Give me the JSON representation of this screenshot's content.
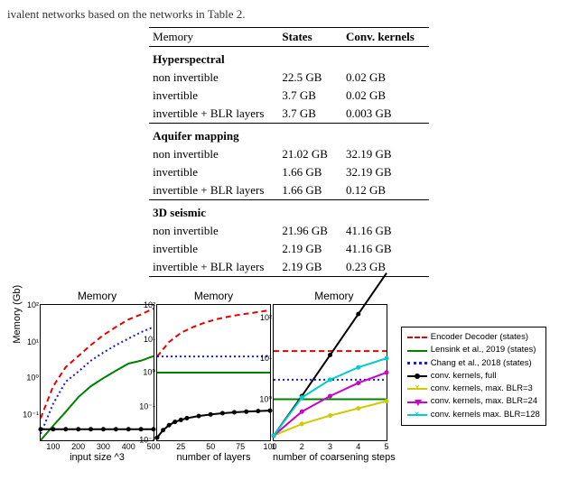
{
  "caption_fragment": "ivalent networks based on the networks in Table 2.",
  "table": {
    "headers": [
      "Memory",
      "States",
      "Conv. kernels"
    ],
    "sections": [
      {
        "title": "Hyperspectral",
        "rows": [
          {
            "name": "non invertible",
            "states": "22.5 GB",
            "kernels": "0.02 GB"
          },
          {
            "name": "invertible",
            "states": "3.7 GB",
            "kernels": "0.02 GB"
          },
          {
            "name": "invertible + BLR layers",
            "states": "3.7 GB",
            "kernels": "0.003 GB"
          }
        ]
      },
      {
        "title": "Aquifer mapping",
        "rows": [
          {
            "name": "non invertible",
            "states": "21.02 GB",
            "kernels": "32.19 GB"
          },
          {
            "name": "invertible",
            "states": "1.66 GB",
            "kernels": "32.19 GB"
          },
          {
            "name": "invertible + BLR layers",
            "states": "1.66 GB",
            "kernels": "0.12 GB"
          }
        ]
      },
      {
        "title": "3D seismic",
        "rows": [
          {
            "name": "non invertible",
            "states": "21.96 GB",
            "kernels": "41.16 GB"
          },
          {
            "name": "invertible",
            "states": "2.19 GB",
            "kernels": "41.16 GB"
          },
          {
            "name": "invertible + BLR layers",
            "states": "2.19 GB",
            "kernels": "0.23 GB"
          }
        ]
      }
    ]
  },
  "charts": {
    "ylabel": "Memory (Gb)",
    "panels": [
      {
        "title": "Memory",
        "xlabel": "input size ^3"
      },
      {
        "title": "Memory",
        "xlabel": "number of layers"
      },
      {
        "title": "Memory",
        "xlabel": "number of coarsening steps"
      }
    ],
    "legend": [
      {
        "label": "Encoder Decoder (states)",
        "color": "#e60000",
        "style": "dashed"
      },
      {
        "label": "Lensink et al., 2019 (states)",
        "color": "#008000",
        "style": "solid"
      },
      {
        "label": "Chang et al., 2018 (states)",
        "color": "#1a1ae6",
        "style": "dotted"
      },
      {
        "label": "conv. kernels, full",
        "color": "#000000",
        "style": "solid",
        "marker": "circle"
      },
      {
        "label": "conv. kernels, max. BLR=3",
        "color": "#cccc00",
        "style": "solid",
        "marker": "cross"
      },
      {
        "label": "conv. kernels, max. BLR=24",
        "color": "#cc00cc",
        "style": "solid",
        "marker": "tri"
      },
      {
        "label": "conv. kernels max. BLR=128",
        "color": "#00cccc",
        "style": "solid",
        "marker": "x"
      }
    ]
  },
  "chart_data": [
    {
      "type": "line",
      "title": "Memory",
      "xlabel": "input size ^3",
      "ylabel": "Memory (Gb)",
      "xlim": [
        50,
        500
      ],
      "ylim": [
        0.02,
        100
      ],
      "yscale": "log",
      "xticks": [
        100,
        200,
        300,
        400,
        500
      ],
      "yticks": [
        0.1,
        1,
        10,
        100
      ],
      "series": [
        {
          "name": "Encoder Decoder (states)",
          "x": [
            50,
            100,
            150,
            200,
            250,
            300,
            350,
            400,
            450,
            500
          ],
          "y": [
            0.08,
            0.6,
            2,
            4,
            8,
            15,
            25,
            40,
            55,
            80
          ]
        },
        {
          "name": "Lensink et al., 2019 (states)",
          "x": [
            50,
            100,
            150,
            200,
            250,
            300,
            350,
            400,
            450,
            500
          ],
          "y": [
            0.02,
            0.05,
            0.12,
            0.3,
            0.6,
            1,
            1.6,
            2.5,
            3,
            4
          ]
        },
        {
          "name": "Chang et al., 2018 (states)",
          "x": [
            50,
            100,
            150,
            200,
            250,
            300,
            350,
            400,
            450,
            500
          ],
          "y": [
            0.03,
            0.2,
            0.8,
            1.5,
            3,
            5,
            8,
            12,
            18,
            25
          ]
        },
        {
          "name": "conv. kernels, full",
          "x": [
            50,
            100,
            150,
            200,
            250,
            300,
            350,
            400,
            450,
            500
          ],
          "y": [
            0.04,
            0.04,
            0.04,
            0.04,
            0.04,
            0.04,
            0.04,
            0.04,
            0.04,
            0.04
          ]
        }
      ]
    },
    {
      "type": "line",
      "title": "Memory",
      "xlabel": "number of layers",
      "ylabel": "Memory (Gb)",
      "xlim": [
        5,
        100
      ],
      "ylim": [
        0.01,
        100
      ],
      "yscale": "log",
      "xticks": [
        25,
        50,
        75,
        100
      ],
      "yticks": [
        0.01,
        0.1,
        1,
        10,
        100
      ],
      "series": [
        {
          "name": "Encoder Decoder (states)",
          "x": [
            5,
            15,
            25,
            35,
            45,
            55,
            65,
            75,
            85,
            100
          ],
          "y": [
            3,
            8,
            15,
            22,
            30,
            38,
            45,
            52,
            58,
            70
          ]
        },
        {
          "name": "Lensink et al., 2019 (states)",
          "x": [
            5,
            100
          ],
          "y": [
            1,
            1
          ]
        },
        {
          "name": "Chang et al., 2018 (states)",
          "x": [
            5,
            100
          ],
          "y": [
            3,
            3
          ]
        },
        {
          "name": "conv. kernels, full",
          "x": [
            5,
            10,
            15,
            20,
            25,
            30,
            40,
            50,
            60,
            70,
            80,
            90,
            100
          ],
          "y": [
            0.012,
            0.02,
            0.028,
            0.035,
            0.04,
            0.045,
            0.052,
            0.058,
            0.063,
            0.067,
            0.07,
            0.073,
            0.075
          ]
        }
      ]
    },
    {
      "type": "line",
      "title": "Memory",
      "xlabel": "number of coarsening steps",
      "ylabel": "Memory (Gb)",
      "xlim": [
        1,
        5
      ],
      "ylim": [
        0.1,
        200
      ],
      "yscale": "log",
      "xticks": [
        1,
        2,
        3,
        4,
        5
      ],
      "yticks": [
        1,
        10,
        100
      ],
      "series": [
        {
          "name": "Encoder Decoder (states)",
          "x": [
            1,
            5
          ],
          "y": [
            15,
            15
          ]
        },
        {
          "name": "Lensink et al., 2019 (states)",
          "x": [
            1,
            5
          ],
          "y": [
            1,
            1
          ]
        },
        {
          "name": "Chang et al., 2018 (states)",
          "x": [
            1,
            5
          ],
          "y": [
            3,
            3
          ]
        },
        {
          "name": "conv. kernels, full",
          "x": [
            1,
            2,
            3,
            4,
            5
          ],
          "y": [
            0.13,
            1.2,
            12,
            120,
            1200
          ]
        },
        {
          "name": "conv. kernels, max. BLR=3",
          "x": [
            1,
            2,
            3,
            4,
            5
          ],
          "y": [
            0.13,
            0.25,
            0.4,
            0.6,
            0.9
          ]
        },
        {
          "name": "conv. kernels, max. BLR=24",
          "x": [
            1,
            2,
            3,
            4,
            5
          ],
          "y": [
            0.13,
            0.5,
            1.2,
            2.5,
            4.5
          ]
        },
        {
          "name": "conv. kernels max. BLR=128",
          "x": [
            1,
            2,
            3,
            4,
            5
          ],
          "y": [
            0.13,
            1.1,
            3,
            6,
            10
          ]
        }
      ]
    }
  ]
}
